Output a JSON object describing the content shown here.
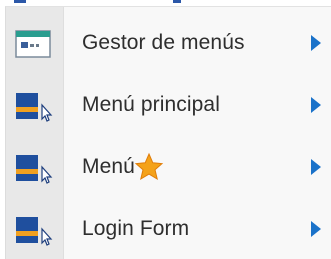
{
  "menu": {
    "items": [
      {
        "label": "Gestor de menús",
        "icon": "menu-manager-icon",
        "has_submenu": true
      },
      {
        "label": "Menú principal",
        "icon": "menu-module-icon",
        "has_submenu": true
      },
      {
        "label": "Menú",
        "icon": "menu-module-icon",
        "has_submenu": true,
        "badge_icon": "star-icon"
      },
      {
        "label": "Login Form",
        "icon": "menu-module-icon",
        "has_submenu": true
      }
    ]
  },
  "colors": {
    "accent": "#1a72c9",
    "star": "#f4a21a",
    "icon_blue": "#1f4f9e",
    "icon_orange": "#f0a020",
    "gutter": "#e8e8e8",
    "menu_bg": "#f8f8f8"
  }
}
